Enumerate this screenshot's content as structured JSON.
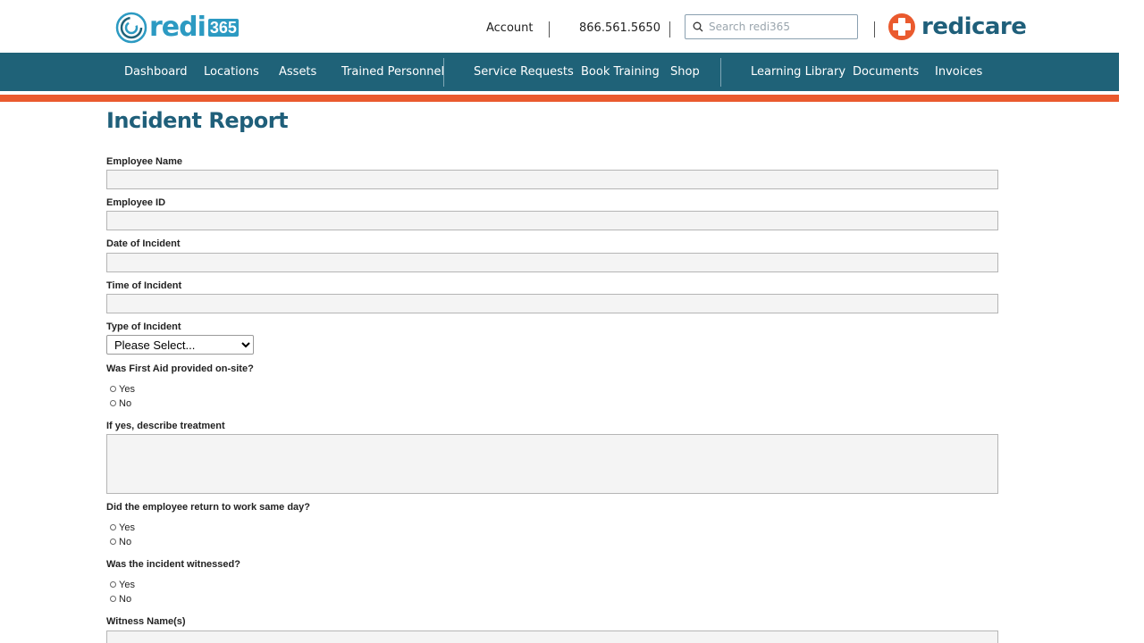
{
  "header": {
    "logo_text": "redi",
    "logo_badge": "365",
    "account_label": "Account",
    "phone": "866.561.5650",
    "search_placeholder": "Search redi365",
    "brand_text": "redicare"
  },
  "nav": {
    "items": [
      "Dashboard",
      "Locations",
      "Assets",
      "Trained Personnel",
      "Service Requests",
      "Book Training",
      "Shop",
      "Learning Library",
      "Documents",
      "Invoices"
    ]
  },
  "page": {
    "title": "Incident Report"
  },
  "form": {
    "employee_name_label": "Employee Name",
    "employee_id_label": "Employee ID",
    "date_label": "Date of Incident",
    "time_label": "Time of Incident",
    "type_label": "Type of Incident",
    "type_selected": "Please Select...",
    "first_aid_label": "Was First Aid provided on-site?",
    "treatment_label": "If yes, describe treatment",
    "return_label": "Did the employee return to work same day?",
    "witnessed_label": "Was the incident witnessed?",
    "witness_names_label": "Witness Name(s)",
    "yes": "Yes",
    "no": "No"
  },
  "colors": {
    "nav_bg": "#1f6278",
    "accent_orange": "#ea5a2e",
    "brand_blue": "#2c9ac2",
    "title_color": "#1f5f7a"
  }
}
